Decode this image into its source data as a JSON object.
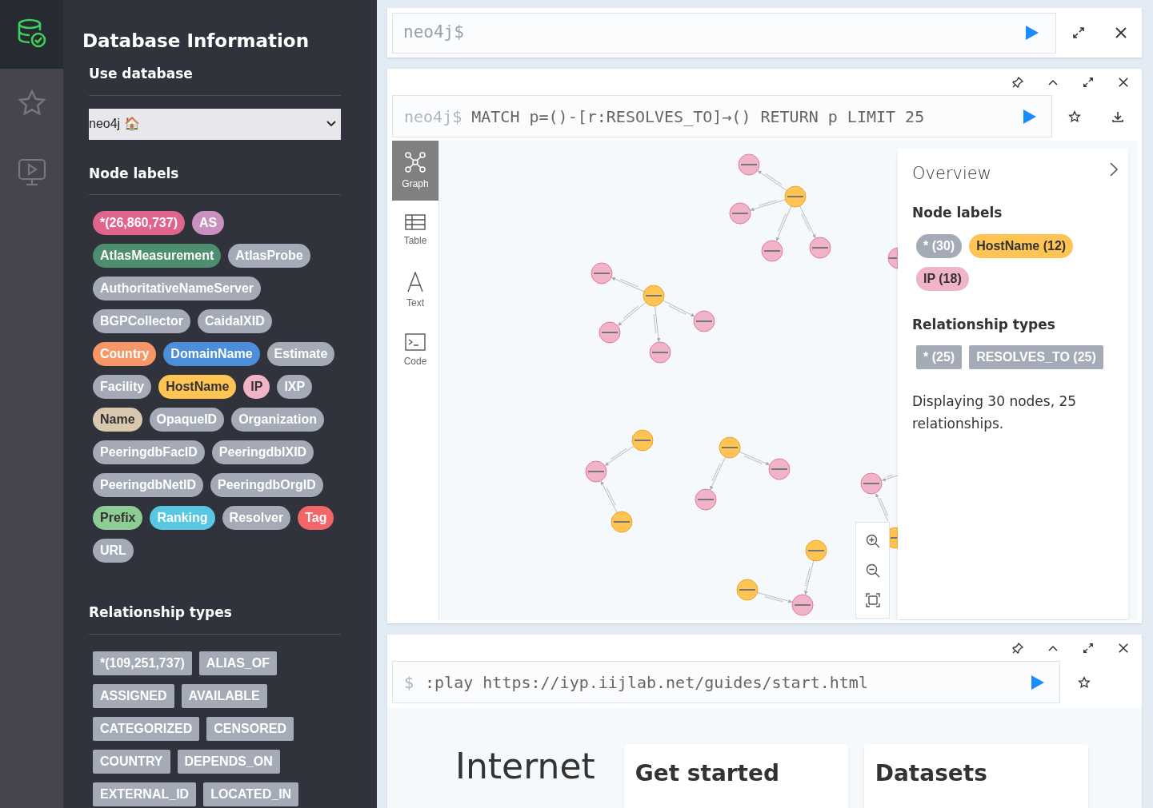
{
  "database_panel": {
    "title": "Database Information",
    "use_database": {
      "heading": "Use database",
      "value": "neo4j 🏠"
    },
    "node_labels": {
      "heading": "Node labels",
      "items": [
        {
          "label": "*(26,860,737)",
          "color": "#e0648b"
        },
        {
          "label": "AS",
          "color": "#c990c0"
        },
        {
          "label": "AtlasMeasurement",
          "color": "#4c8e6e"
        },
        {
          "label": "AtlasProbe",
          "color": "#a5abb6"
        },
        {
          "label": "AuthoritativeNameServer",
          "color": "#a5abb6"
        },
        {
          "label": "BGPCollector",
          "color": "#a5abb6"
        },
        {
          "label": "CaidaIXID",
          "color": "#a5abb6"
        },
        {
          "label": "Country",
          "color": "#f79767"
        },
        {
          "label": "DomainName",
          "color": "#4c8eda"
        },
        {
          "label": "Estimate",
          "color": "#a5abb6"
        },
        {
          "label": "Facility",
          "color": "#a5abb6"
        },
        {
          "label": "HostName",
          "color": "#ffc454"
        },
        {
          "label": "IP",
          "color": "#f0b3c8"
        },
        {
          "label": "IXP",
          "color": "#a5abb6"
        },
        {
          "label": "Name",
          "color": "#d9c8ae"
        },
        {
          "label": "OpaqueID",
          "color": "#a5abb6"
        },
        {
          "label": "Organization",
          "color": "#a5abb6"
        },
        {
          "label": "PeeringdbFacID",
          "color": "#a5abb6"
        },
        {
          "label": "PeeringdbIXID",
          "color": "#a5abb6"
        },
        {
          "label": "PeeringdbNetID",
          "color": "#a5abb6"
        },
        {
          "label": "PeeringdbOrgID",
          "color": "#a5abb6"
        },
        {
          "label": "Prefix",
          "color": "#8dcc93"
        },
        {
          "label": "Ranking",
          "color": "#57c7e3"
        },
        {
          "label": "Resolver",
          "color": "#a5abb6"
        },
        {
          "label": "Tag",
          "color": "#f16667"
        },
        {
          "label": "URL",
          "color": "#a5abb6"
        }
      ]
    },
    "relationship_types": {
      "heading": "Relationship types",
      "items": [
        "*(109,251,737)",
        "ALIAS_OF",
        "ASSIGNED",
        "AVAILABLE",
        "CATEGORIZED",
        "CENSORED",
        "COUNTRY",
        "DEPENDS_ON",
        "EXTERNAL_ID",
        "LOCATED_IN"
      ]
    }
  },
  "editor": {
    "prompt": "neo4j$"
  },
  "result_frame": {
    "prompt": "neo4j$",
    "query": "MATCH p=()-[r:RESOLVES_TO]→() RETURN p LIMIT 25",
    "view_tabs": [
      {
        "label": "Graph",
        "selected": true
      },
      {
        "label": "Table",
        "selected": false
      },
      {
        "label": "Text",
        "selected": false
      },
      {
        "label": "Code",
        "selected": false
      }
    ],
    "graph": {
      "nodes": [
        {
          "kind": "ip"
        },
        {
          "kind": "host"
        },
        {
          "kind": "ip"
        },
        {
          "kind": "ip"
        },
        {
          "kind": "ip"
        },
        {
          "kind": "ip"
        },
        {
          "kind": "ip"
        },
        {
          "kind": "host"
        },
        {
          "kind": "ip"
        },
        {
          "kind": "ip"
        },
        {
          "kind": "ip"
        },
        {
          "kind": "host"
        },
        {
          "kind": "ip"
        },
        {
          "kind": "host"
        },
        {
          "kind": "host"
        },
        {
          "kind": "ip"
        },
        {
          "kind": "ip"
        },
        {
          "kind": "ip"
        },
        {
          "kind": "host"
        },
        {
          "kind": "host"
        },
        {
          "kind": "host"
        },
        {
          "kind": "ip"
        }
      ]
    },
    "overview": {
      "title": "Overview",
      "node_labels_heading": "Node labels",
      "node_labels": [
        {
          "label": "* (30)",
          "color": "#a5abb6"
        },
        {
          "label": "HostName (12)",
          "color": "#ffc454"
        },
        {
          "label": "IP (18)",
          "color": "#f0b3c8"
        }
      ],
      "relationship_types_heading": "Relationship types",
      "relationship_types": [
        "* (25)",
        "RESOLVES_TO (25)"
      ],
      "summary": "Displaying 30 nodes, 25 relationships."
    }
  },
  "guide_frame": {
    "prompt": "$",
    "command": ":play https://iyp.iijlab.net/guides/start.html",
    "title": "Internet",
    "cards": [
      {
        "title": "Get started"
      },
      {
        "title": "Datasets"
      }
    ]
  }
}
